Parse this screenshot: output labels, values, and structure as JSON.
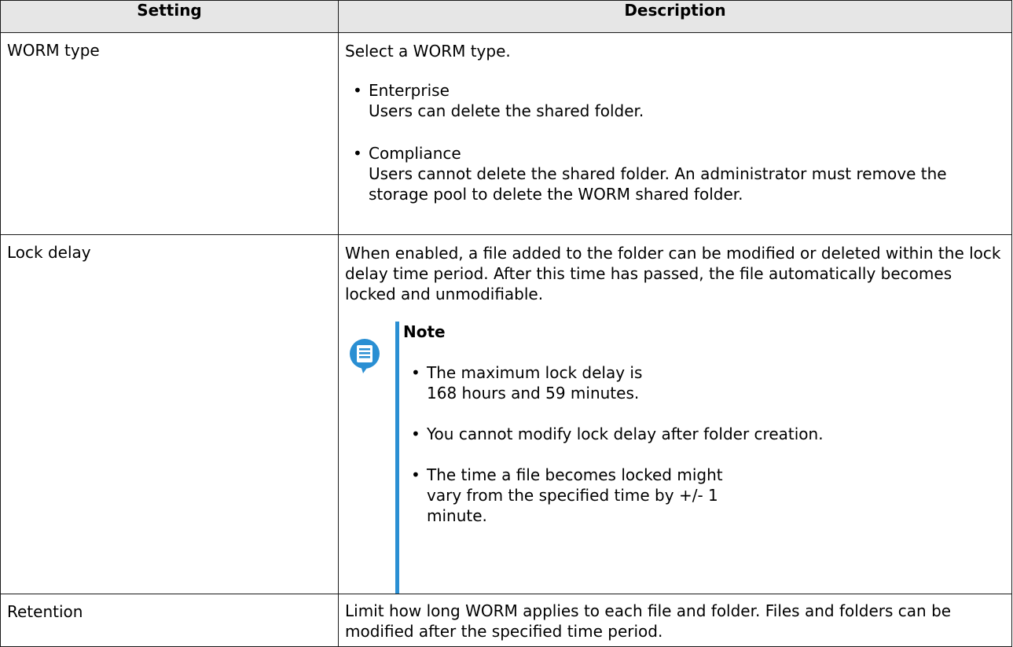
{
  "table": {
    "headers": {
      "setting": "Setting",
      "description": "Description"
    },
    "rows": [
      {
        "setting": "WORM type",
        "intro": "Select a WORM type.",
        "options": [
          {
            "title": "Enterprise",
            "body": "Users can delete the shared folder."
          },
          {
            "title": "Compliance",
            "body": "Users cannot delete the shared folder. An administrator must remove the storage pool to delete the WORM shared folder."
          }
        ]
      },
      {
        "setting": "Lock delay",
        "intro": "When enabled, a file added to the folder can be modified or deleted within the lock delay time period. After this time has passed, the file automatically becomes locked and unmodifiable.",
        "note": {
          "icon": "note-icon",
          "title": "Note",
          "items": [
            "The maximum lock delay is 168 hours and 59 minutes.",
            "You cannot modify lock delay after folder creation.",
            "The time a file becomes locked might vary from the specified time by +/- 1 minute."
          ]
        }
      },
      {
        "setting": "Retention",
        "intro": "Limit how long WORM applies to each file and folder. Files and folders can be modified after the specified time period."
      }
    ]
  },
  "colors": {
    "header_bg": "#e6e6e6",
    "border": "#1a1a1a",
    "note_accent": "#2a8fd3"
  }
}
